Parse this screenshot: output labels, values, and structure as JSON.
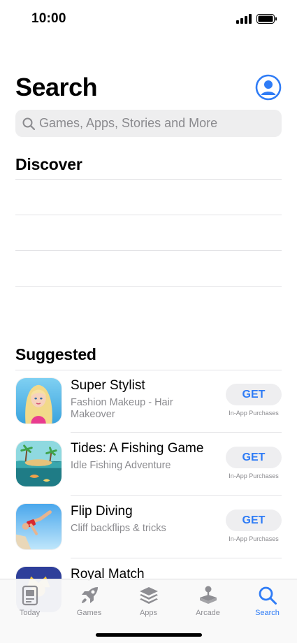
{
  "status_bar": {
    "time": "10:00"
  },
  "header": {
    "title": "Search"
  },
  "search": {
    "placeholder": "Games, Apps, Stories and More",
    "value": ""
  },
  "discover": {
    "title": "Discover"
  },
  "suggested": {
    "title": "Suggested",
    "apps": [
      {
        "name": "Super Stylist",
        "subtitle": "Fashion Makeup - Hair Makeover",
        "button": "GET",
        "note": "In-App Purchases"
      },
      {
        "name": "Tides: A Fishing Game",
        "subtitle": "Idle Fishing Adventure",
        "button": "GET",
        "note": "In-App Purchases"
      },
      {
        "name": "Flip Diving",
        "subtitle": "Cliff backflips & tricks",
        "button": "GET",
        "note": "In-App Purchases"
      },
      {
        "name": "Royal Match"
      }
    ]
  },
  "tab_bar": {
    "tabs": [
      {
        "label": "Today",
        "icon": "today-icon"
      },
      {
        "label": "Games",
        "icon": "rocket-icon"
      },
      {
        "label": "Apps",
        "icon": "apps-stack-icon"
      },
      {
        "label": "Arcade",
        "icon": "joystick-icon"
      },
      {
        "label": "Search",
        "icon": "search-icon"
      }
    ],
    "active": "Search"
  },
  "colors": {
    "accent": "#2f7cf6",
    "secondary_text": "#8a8a8e",
    "search_bg": "#eeeeef"
  }
}
